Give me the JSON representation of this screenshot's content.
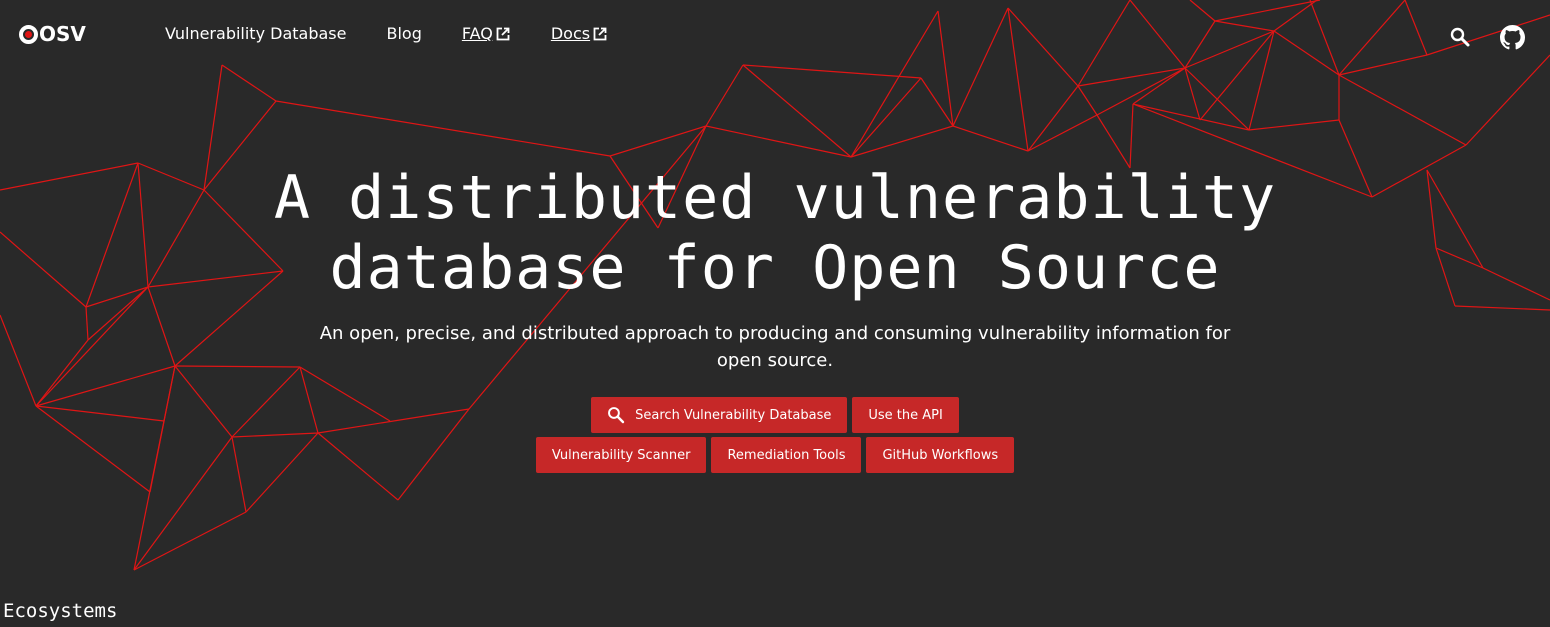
{
  "header": {
    "logo_text": "OSV",
    "nav": {
      "vuln_db": "Vulnerability Database",
      "blog": "Blog",
      "faq": "FAQ",
      "docs": "Docs"
    },
    "icons": {
      "search": "search-icon",
      "github": "github-icon",
      "external": "external-link-icon"
    }
  },
  "hero": {
    "title_line1": "A distributed vulnerability",
    "title_line2": "database for Open Source",
    "subtitle": "An open, precise, and distributed approach to producing and consuming vulnerability information for open source.",
    "buttons": {
      "search_db": "Search Vulnerability Database",
      "api": "Use the API",
      "scanner": "Vulnerability Scanner",
      "remediation": "Remediation Tools",
      "workflows": "GitHub Workflows"
    }
  },
  "sections": {
    "ecosystems_heading": "Ecosystems"
  },
  "colors": {
    "background": "#292929",
    "accent": "#c62828",
    "lines": "#e01515",
    "text": "#ffffff"
  }
}
